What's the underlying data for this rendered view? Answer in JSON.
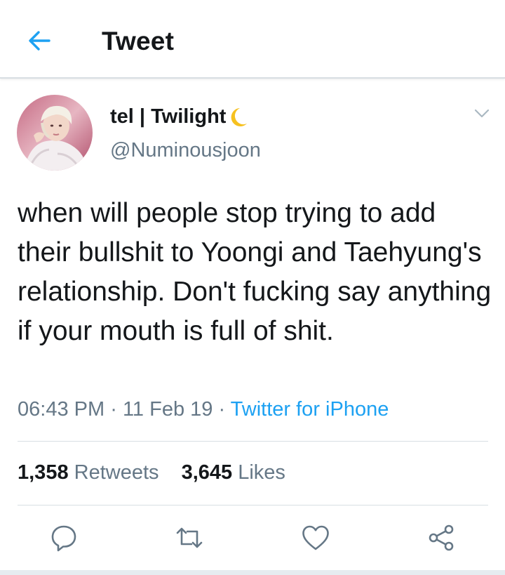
{
  "header": {
    "title": "Tweet",
    "back_icon": "arrow-left-icon",
    "accent": "#1da1f2"
  },
  "tweet": {
    "display_name": "tel | Twilight",
    "name_emoji": "crescent-moon-icon",
    "handle": "@Numinousjoon",
    "text": "when will people stop trying to add their bullshit to Yoongi and Taehyung's relationship. Don't fucking say anything if your mouth is full of shit.",
    "time": "06:43 PM",
    "date": "11 Feb 19",
    "separator": "·",
    "source": "Twitter for iPhone"
  },
  "stats": {
    "retweets_count": "1,358",
    "retweets_label": "Retweets",
    "likes_count": "3,645",
    "likes_label": "Likes"
  },
  "actions": [
    "reply-icon",
    "retweet-icon",
    "like-icon",
    "share-icon"
  ]
}
